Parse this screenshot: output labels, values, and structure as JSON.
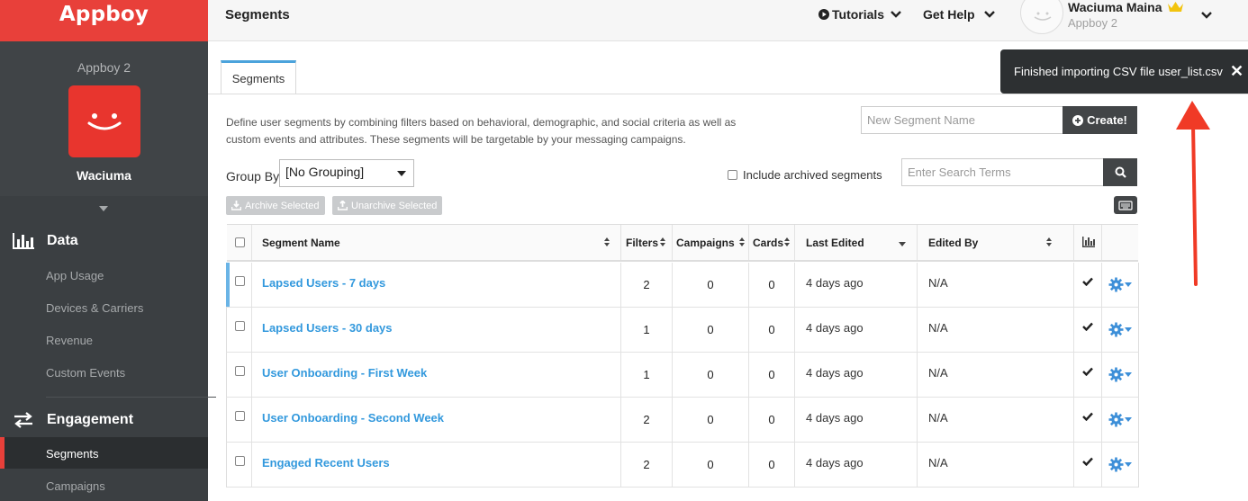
{
  "sidebar": {
    "brand": "Appboy",
    "app_group": "Appboy 2",
    "app_name": "Waciuma",
    "sections": {
      "data": {
        "title": "Data",
        "items": [
          "App Usage",
          "Devices & Carriers",
          "Revenue",
          "Custom Events"
        ]
      },
      "engagement": {
        "title": "Engagement",
        "items": [
          "Segments",
          "Campaigns"
        ]
      }
    }
  },
  "header": {
    "title": "Segments",
    "tutorials": "Tutorials",
    "get_help": "Get Help",
    "user_name": "Waciuma Maina",
    "user_app": "Appboy 2"
  },
  "tabs": [
    "Segments"
  ],
  "description": "Define user segments by combining filters based on behavioral, demographic, and social criteria as well as custom events and attributes. These segments will be targetable by your messaging campaigns.",
  "new_segment": {
    "placeholder": "New Segment Name",
    "create_label": "Create!"
  },
  "group_by": {
    "label": "Group By",
    "selected": "[No Grouping]"
  },
  "include_archived": "Include archived segments",
  "search": {
    "placeholder": "Enter Search Terms"
  },
  "actions": {
    "archive": "Archive Selected",
    "unarchive": "Unarchive Selected"
  },
  "table": {
    "columns": [
      "Segment Name",
      "Filters",
      "Campaigns",
      "Cards",
      "Last Edited",
      "Edited By"
    ],
    "rows": [
      {
        "name": "Lapsed Users - 7 days",
        "filters": "2",
        "campaigns": "0",
        "cards": "0",
        "last_edited": "4 days ago",
        "edited_by": "N/A"
      },
      {
        "name": "Lapsed Users - 30 days",
        "filters": "1",
        "campaigns": "0",
        "cards": "0",
        "last_edited": "4 days ago",
        "edited_by": "N/A"
      },
      {
        "name": "User Onboarding - First Week",
        "filters": "1",
        "campaigns": "0",
        "cards": "0",
        "last_edited": "4 days ago",
        "edited_by": "N/A"
      },
      {
        "name": "User Onboarding - Second Week",
        "filters": "2",
        "campaigns": "0",
        "cards": "0",
        "last_edited": "4 days ago",
        "edited_by": "N/A"
      },
      {
        "name": "Engaged Recent Users",
        "filters": "2",
        "campaigns": "0",
        "cards": "0",
        "last_edited": "4 days ago",
        "edited_by": "N/A"
      }
    ]
  },
  "toast": {
    "message": "Finished importing CSV file user_list.csv"
  },
  "colors": {
    "brand_red": "#e8403a",
    "link_blue": "#3399dd",
    "sidebar_bg": "#3b3f42",
    "toast_bg": "#2d3032",
    "arrow_red": "#f03a26"
  }
}
